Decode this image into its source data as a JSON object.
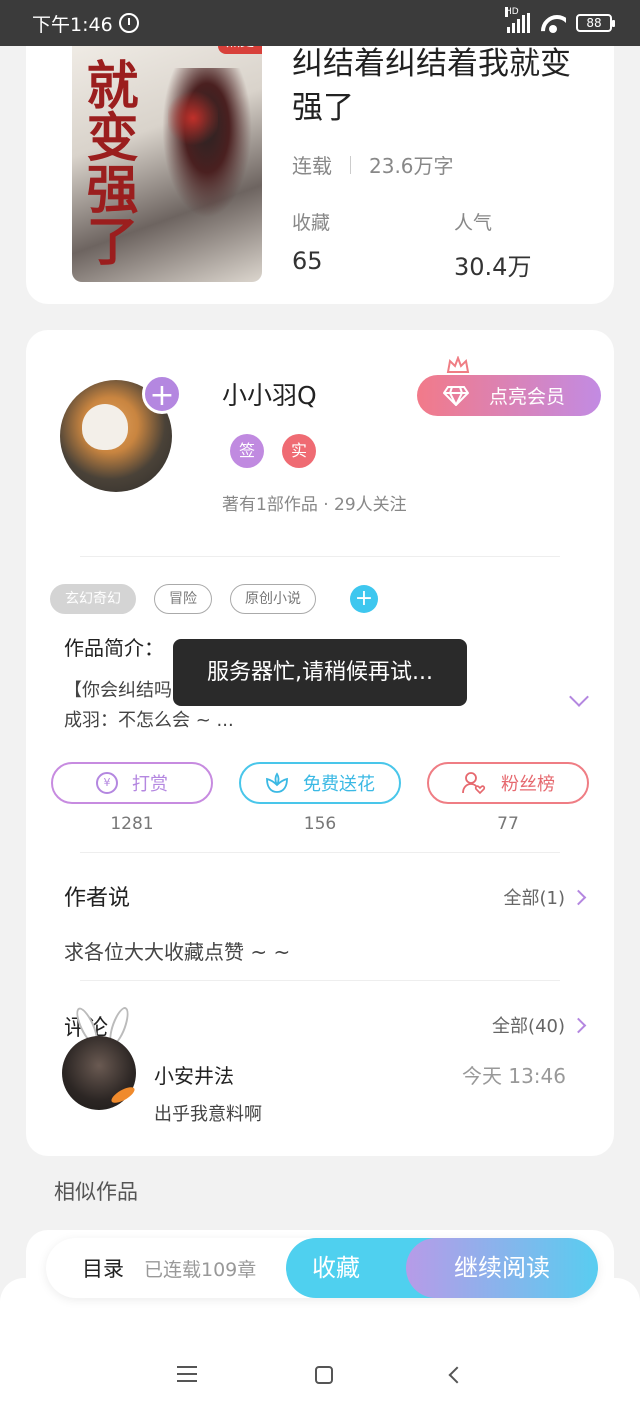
{
  "status_bar": {
    "time": "下午1:46",
    "battery": "88",
    "hd": "HD"
  },
  "book": {
    "tag": "热更",
    "cover_text": "就变强了",
    "title": "纠结着纠结着我就变强了",
    "status": "连载",
    "words": "23.6万字",
    "stats": [
      {
        "label": "收藏",
        "value": "65"
      },
      {
        "label": "人气",
        "value": "30.4万"
      }
    ]
  },
  "author": {
    "name": "小小羽Q",
    "badges": [
      "签",
      "实"
    ],
    "meta": "著有1部作品 · 29人关注",
    "vip_label": "点亮会员"
  },
  "tags": [
    "玄幻奇幻",
    "冒险",
    "原创小说"
  ],
  "intro": {
    "label": "作品简介：",
    "line1": "【你会纠结吗?】",
    "line2": "成羽：不怎么会 ~ ..."
  },
  "toast": "服务器忙,请稍候再试...",
  "actions": [
    {
      "label": "打赏",
      "count": "1281",
      "icon": "¥"
    },
    {
      "label": "免费送花",
      "count": "156",
      "icon": "flower-icon"
    },
    {
      "label": "粉丝榜",
      "count": "77",
      "icon": "fans-icon"
    }
  ],
  "author_says": {
    "title": "作者说",
    "more": "全部(1)",
    "text": "求各位大大收藏点赞 ~ ~"
  },
  "comments": {
    "title": "评论",
    "more": "全部(40)",
    "items": [
      {
        "user": "小安井法",
        "time": "今天 13:46",
        "text": "出乎我意料啊"
      }
    ]
  },
  "similar_title": "相似作品",
  "bottom_bar": {
    "toc": "目录",
    "toc_meta": "已连载109章",
    "fav": "收藏",
    "read": "继续阅读"
  },
  "colors": {
    "purple": "#b487e0",
    "cyan": "#4fd0ef",
    "pink": "#ef7d84"
  }
}
